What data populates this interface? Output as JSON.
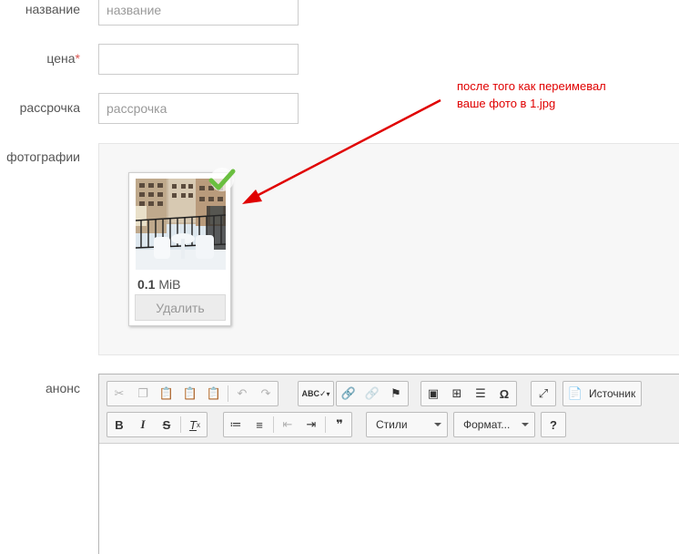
{
  "form": {
    "name": {
      "label": "название",
      "placeholder": "название",
      "value": ""
    },
    "price": {
      "label": "цена",
      "required_mark": "*",
      "value": ""
    },
    "installment": {
      "label": "рассрочка",
      "placeholder": "рассрочка",
      "value": ""
    },
    "photos": {
      "label": "фотографии",
      "file": {
        "size_value": "0.1",
        "size_unit": "MiB",
        "delete_label": "Удалить",
        "status": "success"
      }
    },
    "announce": {
      "label": "анонс"
    }
  },
  "annotation": {
    "line1": "после того как переимевал",
    "line2": "ваше фото в 1.jpg",
    "color": "#e00000"
  },
  "editor": {
    "styles_label": "Стили",
    "format_label": "Формат...",
    "source_label": "Источник",
    "help_label": "?"
  },
  "colors": {
    "required": "#d9534f",
    "check": "#6abf40",
    "annotation": "#e00000"
  }
}
